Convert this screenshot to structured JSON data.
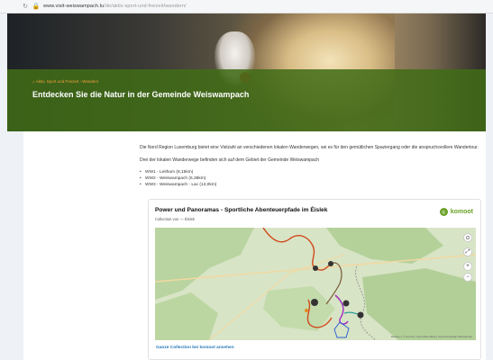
{
  "browser": {
    "url_domain": "www.visit-weiswampach.lu",
    "url_path": "/de/aktiv-sport-und-freizeit/wandern/"
  },
  "hero": {
    "breadcrumb": "⌂ Aktiv, Sport und Freizeit › Wandern",
    "title": "Entdecken Sie die Natur in der Gemeinde Weiswampach"
  },
  "content": {
    "paragraph1": "Die Nord Region Luxemburg bietet eine Vielzahl an verschiedenen lokalen Wanderwegen, sei es für den gemütlichen Spaziergang oder die anspruchsvollere Wandertour.",
    "paragraph2": "Drei der lokalen Wanderwege befinden sich auf dem Gebiet der Gemeinde Weiswampach",
    "trails": [
      "WW1 - Leithum (8,15km)",
      "WW2 - Weiswampach (6,38km)",
      "WW3 - Weiswampach - Lac (13,0km)"
    ]
  },
  "komoot": {
    "title": "Power und Panoramas - Sportliche Abenteuerpfade im Éislek",
    "subtitle": "Collection von — Éislek",
    "brand": "komoot",
    "link": "Ganze Collection bei komoot ansehen",
    "attribution": "Mapbox | © komoot | OpenStreetMap | OpenStreetMap Mitwirkende"
  },
  "colors": {
    "green_band": "#406c16",
    "accent_orange": "#f0a23a",
    "komoot_green": "#6aa127",
    "link_blue": "#2a7ab9"
  }
}
